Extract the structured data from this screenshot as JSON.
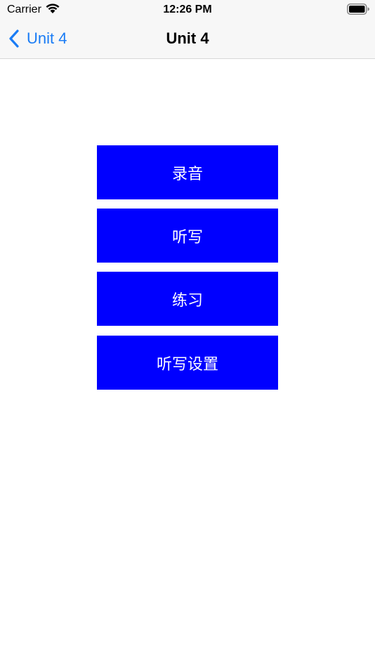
{
  "status_bar": {
    "carrier": "Carrier",
    "time": "12:26 PM",
    "wifi_icon": "wifi-icon",
    "battery_icon": "battery-icon"
  },
  "nav": {
    "back_label": "Unit 4",
    "back_icon": "chevron-left-icon",
    "title": "Unit 4"
  },
  "buttons": [
    {
      "label": "录音"
    },
    {
      "label": "听写"
    },
    {
      "label": "练习"
    },
    {
      "label": "听写设置"
    }
  ],
  "colors": {
    "accent": "#1a7cf5",
    "button_bg": "#0000ff",
    "button_text": "#ffffff"
  }
}
